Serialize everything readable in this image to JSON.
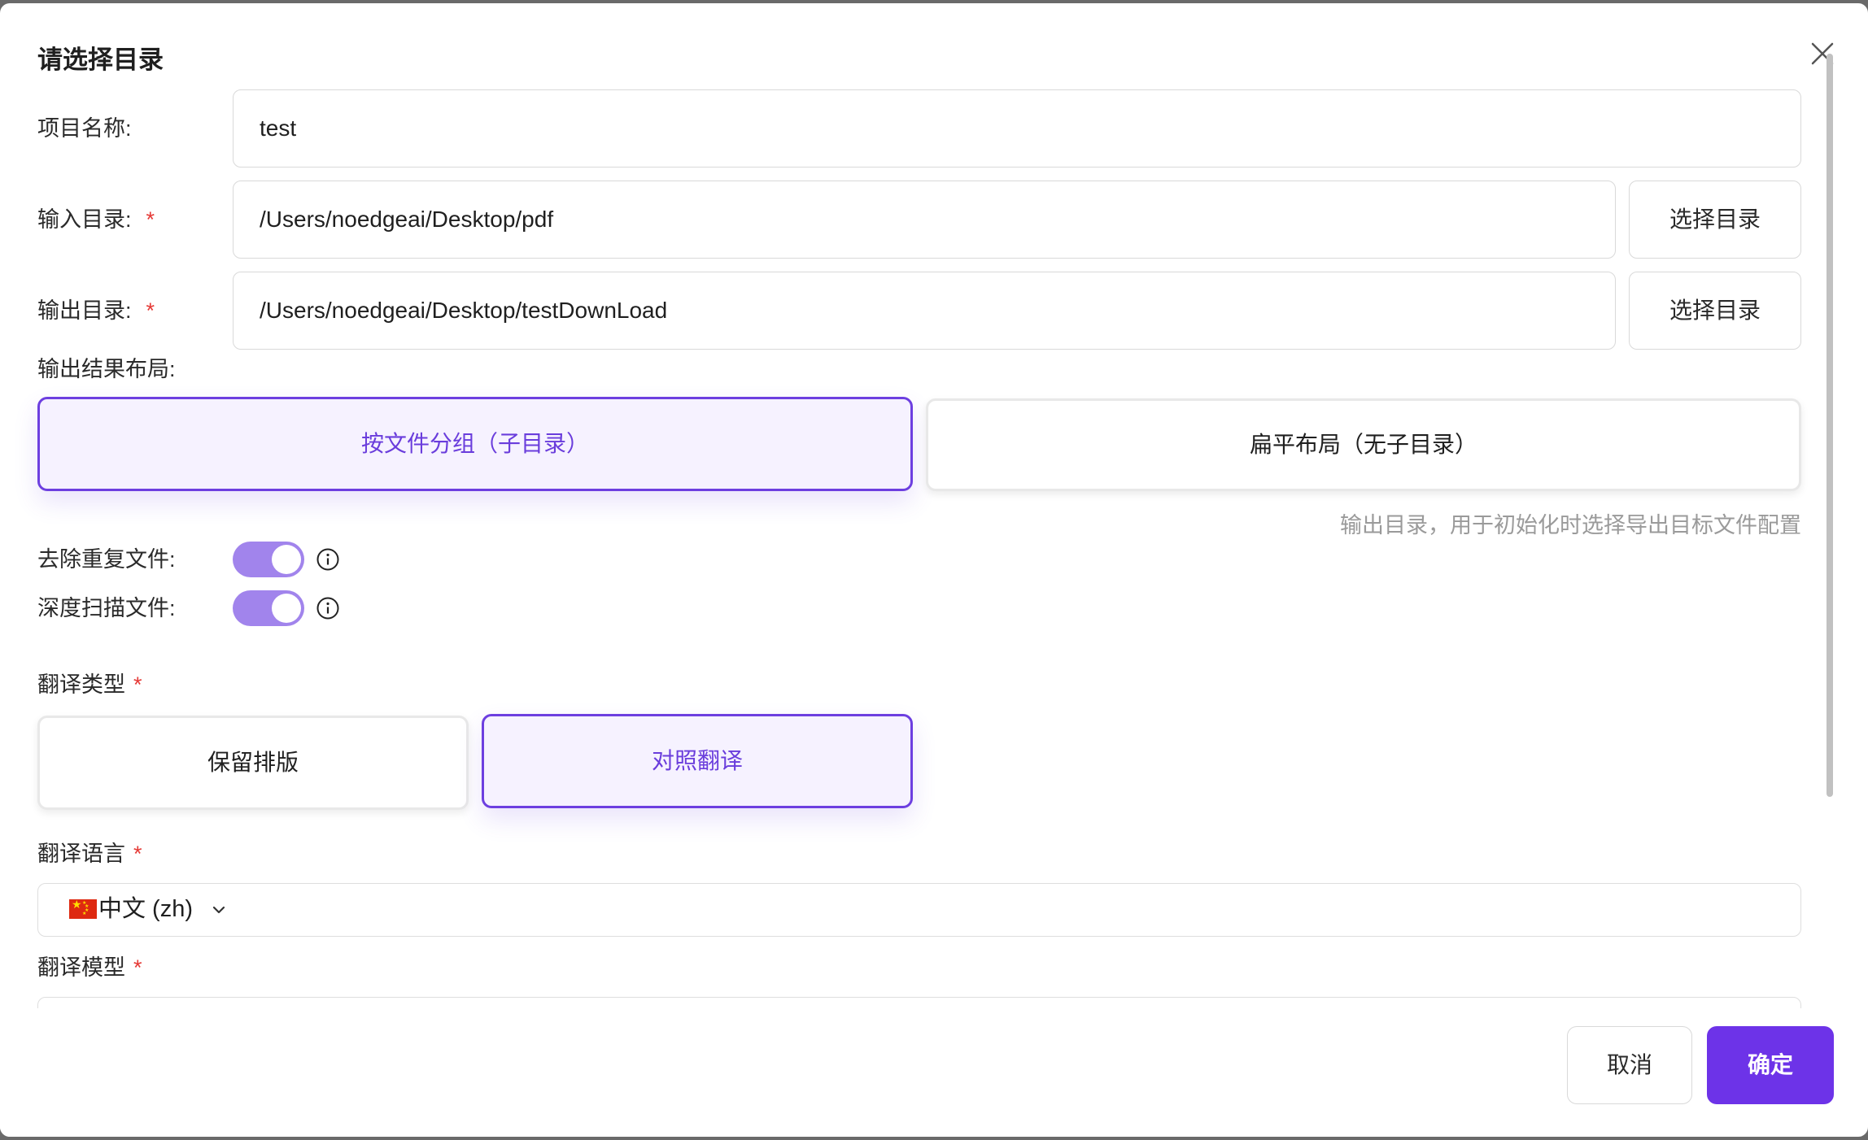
{
  "dialog": {
    "title": "请选择目录",
    "close_icon": "close-icon"
  },
  "project": {
    "label": "项目名称:",
    "value": "test"
  },
  "input_dir": {
    "label": "输入目录:",
    "required": "*",
    "value": "/Users/noedgeai/Desktop/pdf",
    "button": "选择目录"
  },
  "output_dir": {
    "label": "输出目录:",
    "required": "*",
    "value": "/Users/noedgeai/Desktop/testDownLoad",
    "button": "选择目录"
  },
  "layout": {
    "label": "输出结果布局:",
    "options": [
      {
        "label": "按文件分组（子目录）",
        "selected": true
      },
      {
        "label": "扁平布局（无子目录）",
        "selected": false
      }
    ],
    "hint": "输出目录，用于初始化时选择导出目标文件配置"
  },
  "dedupe": {
    "label": "去除重复文件:",
    "enabled": true,
    "info_icon": "info-icon"
  },
  "deep_scan": {
    "label": "深度扫描文件:",
    "enabled": true,
    "info_icon": "info-icon"
  },
  "translate_type": {
    "label": "翻译类型",
    "required": "*",
    "options": [
      {
        "label": "保留排版",
        "selected": false
      },
      {
        "label": "对照翻译",
        "selected": true
      }
    ]
  },
  "translate_lang": {
    "label": "翻译语言",
    "required": "*",
    "flag_icon": "china-flag-icon",
    "value": "中文 (zh)",
    "chevron_icon": "chevron-down-icon"
  },
  "translate_model": {
    "label": "翻译模型",
    "required": "*"
  },
  "footer": {
    "cancel": "取消",
    "confirm": "确定"
  },
  "colors": {
    "accent": "#6d33e8",
    "selected_bg": "#f6f2ff",
    "toggle_on": "#a184ec",
    "required": "#e53935"
  }
}
